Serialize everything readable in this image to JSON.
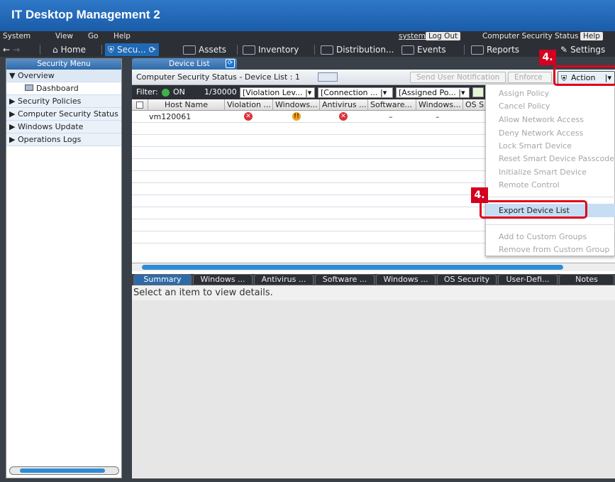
{
  "app": {
    "title": "IT Desktop Management 2"
  },
  "menubar": {
    "items": [
      "System",
      "View",
      "Go",
      "Help"
    ],
    "user": "system",
    "logout": "Log Out",
    "status_page": "Computer Security Status",
    "help": "Help"
  },
  "toolbar": {
    "home": "Home",
    "security": "Secu...",
    "assets": "Assets",
    "inventory": "Inventory",
    "distribution": "Distribution...",
    "events": "Events",
    "reports": "Reports",
    "settings": "Settings"
  },
  "left": {
    "title": "Security Menu",
    "items": [
      {
        "label": "Overview",
        "arrow": "▼"
      },
      {
        "label": "Dashboard"
      },
      {
        "label": "Security Policies",
        "arrow": "▶"
      },
      {
        "label": "Computer Security Status",
        "arrow": "▶"
      },
      {
        "label": "Windows Update",
        "arrow": "▶"
      },
      {
        "label": "Operations Logs",
        "arrow": "▶"
      }
    ]
  },
  "main": {
    "tab": "Device List",
    "header": "Computer Security Status - Device List : 1",
    "send_notification": "Send User Notification",
    "enforce": "Enforce",
    "action": "Action",
    "filter": {
      "label": "Filter:",
      "state": "ON",
      "count": "1/30000",
      "combos": [
        "[Violation Lev...",
        "[Connection ...",
        "[Assigned Po..."
      ]
    },
    "columns": [
      "Host Name",
      "Violation ...",
      "Windows...",
      "Antivirus ...",
      "Software...",
      "Windows...",
      "OS S"
    ],
    "rows": [
      {
        "host": "vm120061",
        "software": "–",
        "windows": "–"
      }
    ],
    "detail_tabs": [
      "Summary",
      "Windows ...",
      "Antivirus ...",
      "Software ...",
      "Windows ...",
      "OS Security",
      "User-Defi...",
      "Notes"
    ],
    "detail_text": "Select an item to view details."
  },
  "action_menu": {
    "items": [
      "Assign Policy",
      "Cancel Policy",
      "Allow Network Access",
      "Deny Network Access",
      "Lock Smart Device",
      "Reset Smart Device Passcode",
      "Initialize Smart Device",
      "Remote Control",
      "Export Device List",
      "Add to Custom Groups",
      "Remove from Custom Group"
    ]
  },
  "annotations": {
    "step1": "4.",
    "step2": "4."
  },
  "colors": {
    "accent": "#1e6ab8",
    "callout": "#d3001f",
    "error": "#d9343a",
    "warning": "#f0a020"
  }
}
